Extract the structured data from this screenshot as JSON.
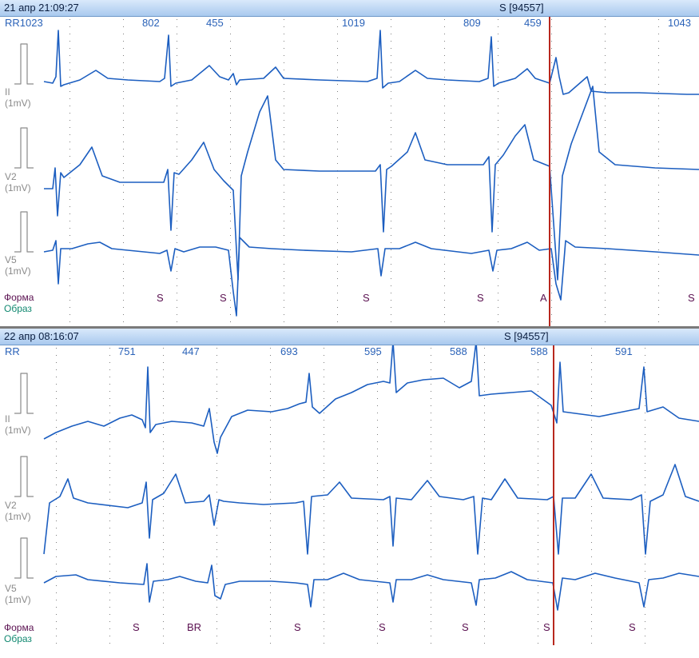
{
  "colors": {
    "trace": "#1c5ec0",
    "header_bg": "#b9d4f2",
    "cursor": "#b8281e",
    "marker_text": "#5a1050",
    "obraz_text": "#108870",
    "grid_dots": "#7f7f7f"
  },
  "panels": [
    {
      "timestamp": "21 апр 21:09:27",
      "beat_label": "S [94557]",
      "rr_prefix": "RR1023",
      "rr_values": [
        "802",
        "455",
        "1019",
        "809",
        "459",
        "1043"
      ],
      "leads": [
        {
          "name": "II",
          "unit": "(1mV)"
        },
        {
          "name": "V2",
          "unit": "(1mV)"
        },
        {
          "name": "V5",
          "unit": "(1mV)"
        }
      ],
      "legend": {
        "forma": "Форма",
        "obraz": "Образ"
      },
      "beat_marks": [
        "S",
        "S",
        "S",
        "S",
        "A",
        "S"
      ]
    },
    {
      "timestamp": "22 апр 08:16:07",
      "beat_label": "S [94557]",
      "rr_prefix": "RR",
      "rr_values": [
        "751",
        "447",
        "693",
        "595",
        "588",
        "588",
        "591"
      ],
      "leads": [
        {
          "name": "II",
          "unit": "(1mV)"
        },
        {
          "name": "V2",
          "unit": "(1mV)"
        },
        {
          "name": "V5",
          "unit": "(1mV)"
        }
      ],
      "legend": {
        "forma": "Форма",
        "obraz": "Образ"
      },
      "beat_marks": [
        "S",
        "BR",
        "S",
        "S",
        "S",
        "S",
        "S"
      ]
    }
  ]
}
